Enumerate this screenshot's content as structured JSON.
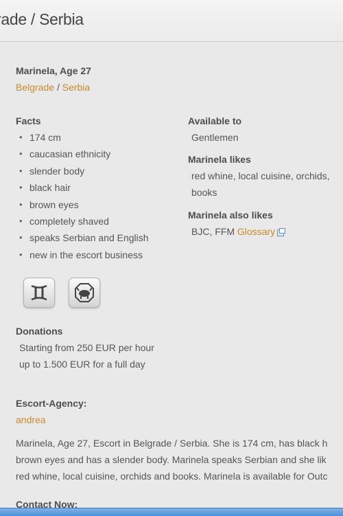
{
  "header": {
    "title": "rade / Serbia"
  },
  "profile": {
    "name_age": "Marinela, Age 27",
    "city": "Belgrade",
    "separator": "/",
    "country": "Serbia"
  },
  "facts": {
    "heading": "Facts",
    "items": [
      "174 cm",
      "caucasian ethnicity",
      "slender body",
      "black hair",
      "brown eyes",
      "completely shaved",
      "speaks Serbian and English",
      "new in the escort business"
    ]
  },
  "zodiac": {
    "sign_icon": "gemini-icon",
    "chinese_icon": "ox-icon"
  },
  "available": {
    "heading": "Available to",
    "value": "Gentlemen"
  },
  "likes": {
    "heading": "Marinela likes",
    "line1": "red whine, local cuisine, orchids,",
    "line2": "books"
  },
  "also_likes": {
    "heading": "Marinela also likes",
    "value": "BJC, FFM",
    "glossary_label": "Glossary"
  },
  "donations": {
    "heading": "Donations",
    "line1": "Starting from 250 EUR per hour",
    "line2": "up to 1.500 EUR for a full day"
  },
  "agency": {
    "heading": "Escort-Agency:",
    "name": "andrea"
  },
  "description": {
    "line1": "Marinela, Age 27, Escort in Belgrade / Serbia. She is 174 cm, has black h",
    "line2": "brown eyes and has a slender body. Marinela speaks Serbian and she lik",
    "line3": "red whine, local cuisine, orchids and books. Marinela is available for Outc"
  },
  "contact": {
    "heading": "Contact Now:"
  },
  "colors": {
    "link": "#c98a2e",
    "background": "#e9e9e9",
    "text": "#555555",
    "heading": "#4d4d4d"
  }
}
